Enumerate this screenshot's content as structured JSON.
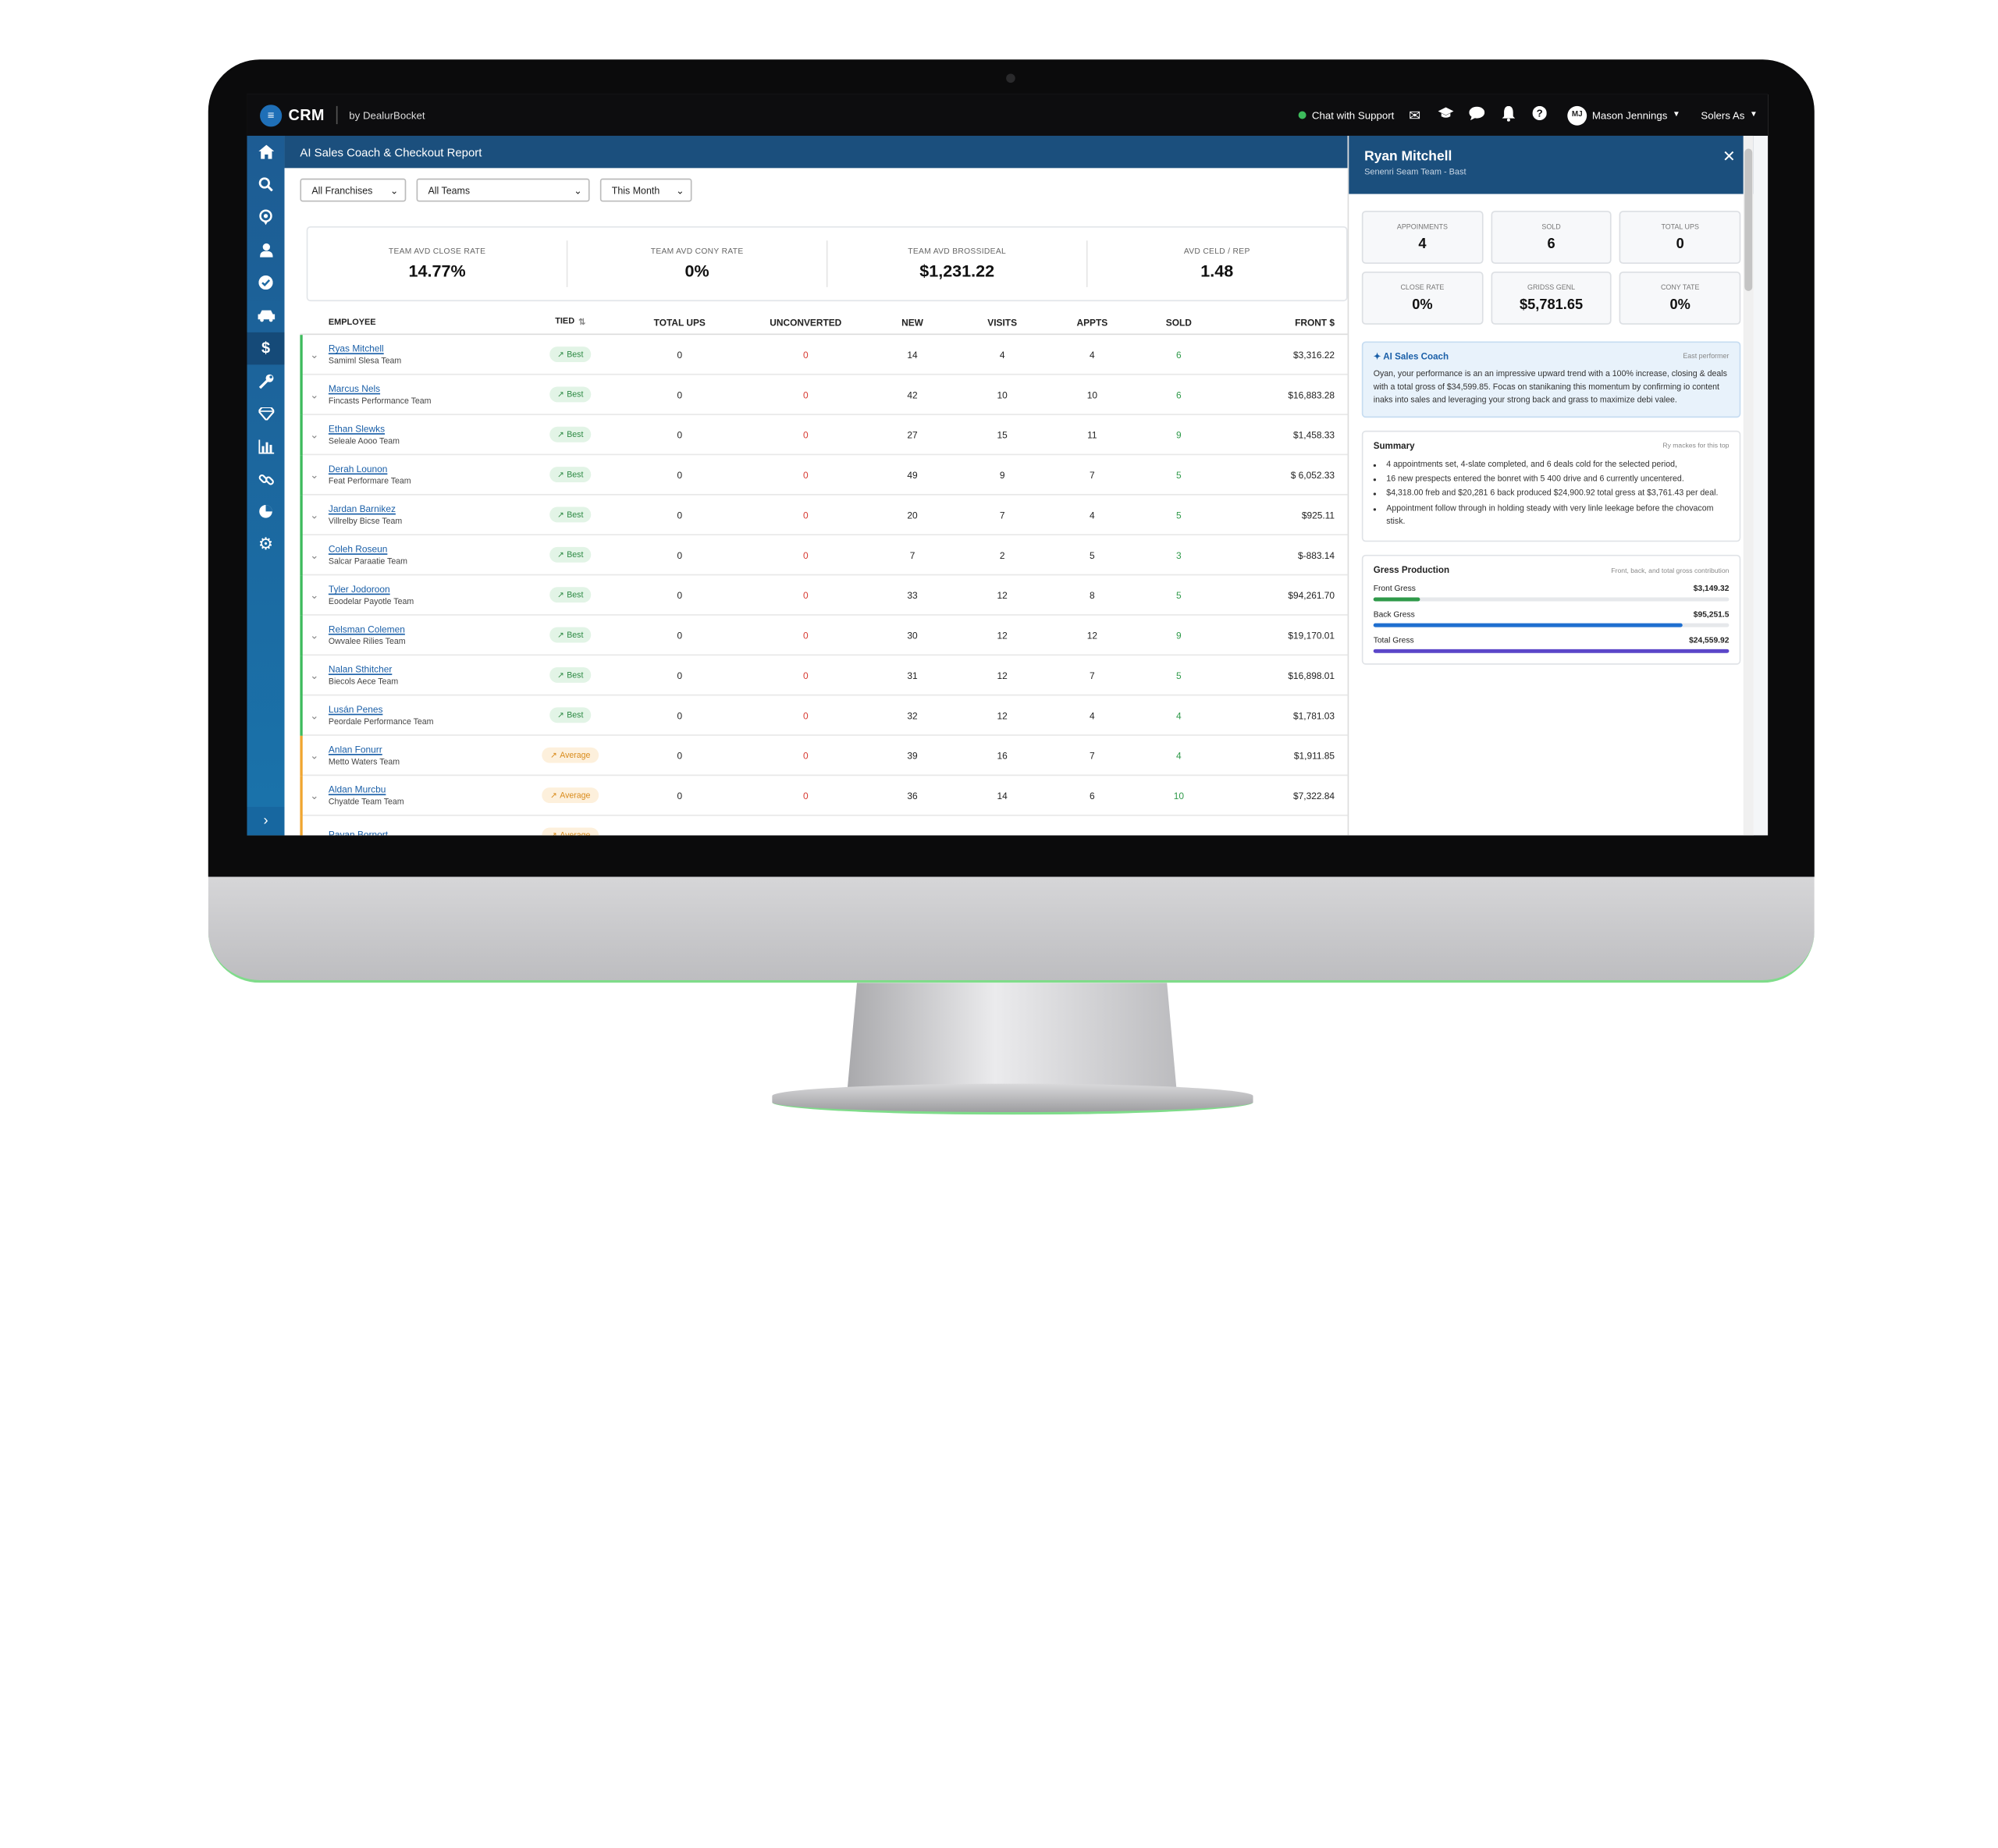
{
  "app": {
    "logo_text": "CRM",
    "by_text": "by DealurBocket",
    "page_title": "AI Sales Coach & Checkout Report"
  },
  "topbar": {
    "chat_label": "Chat with Support",
    "user_initials": "MJ",
    "user_name": "Mason Jennings",
    "store_label": "Solers As"
  },
  "icons": {
    "mail": "mail-icon",
    "education": "graduation-cap-icon",
    "chat": "chat-bubble-icon",
    "bell": "bell-icon",
    "help": "help-icon"
  },
  "sidebar": {
    "items": [
      "home-icon",
      "search-icon",
      "location-icon",
      "user-icon",
      "check-circle-icon",
      "car-icon",
      "dollar-icon",
      "wrench-icon",
      "diamond-icon",
      "bar-chart-icon",
      "link-icon",
      "pie-chart-icon",
      "gear-icon"
    ],
    "active_index": 6,
    "expand": "chevron-right-icon"
  },
  "filters": {
    "franchise": "All Franchises",
    "team": "All Teams",
    "period": "This Month"
  },
  "kpis": [
    {
      "label": "TEAM AVD CLOSE RATE",
      "value": "14.77%"
    },
    {
      "label": "TEAM AVD CONY RATE",
      "value": "0%"
    },
    {
      "label": "TEAM AVD BROSSIDEAL",
      "value": "$1,231.22"
    },
    {
      "label": "AVD CELD / REP",
      "value": "1.48"
    }
  ],
  "table": {
    "headers": {
      "employee": "EMPLOYEE",
      "tied": "TIED",
      "total_ups": "TOTAL UPS",
      "unconverted": "UNCONVERTED",
      "new": "NEW",
      "visits": "VISITS",
      "appts": "APPTS",
      "sold": "SOLD",
      "front": "FRONT $"
    },
    "rows": [
      {
        "name": "Ryas Mitchell",
        "team": "Samiml Slesa Team",
        "tier": "Best",
        "total_ups": "0",
        "unconverted": "0",
        "new": "14",
        "visits": "4",
        "appts": "4",
        "sold": "6",
        "front": "$3,316.22"
      },
      {
        "name": "Marcus Nels",
        "team": "Fincasts Performance Team",
        "tier": "Best",
        "total_ups": "0",
        "unconverted": "0",
        "new": "42",
        "visits": "10",
        "appts": "10",
        "sold": "6",
        "front": "$16,883.28"
      },
      {
        "name": "Ethan Slewks",
        "team": "Seleale Aooo Team",
        "tier": "Best",
        "total_ups": "0",
        "unconverted": "0",
        "new": "27",
        "visits": "15",
        "appts": "11",
        "sold": "9",
        "front": "$1,458.33"
      },
      {
        "name": "Derah Lounon",
        "team": "Feat Performare Team",
        "tier": "Best",
        "total_ups": "0",
        "unconverted": "0",
        "new": "49",
        "visits": "9",
        "appts": "7",
        "sold": "5",
        "front": "$ 6,052.33"
      },
      {
        "name": "Jardan Barnikez",
        "team": "Villrelby Bicse Team",
        "tier": "Best",
        "total_ups": "0",
        "unconverted": "0",
        "new": "20",
        "visits": "7",
        "appts": "4",
        "sold": "5",
        "front": "$925.11"
      },
      {
        "name": "Coleh Roseun",
        "team": "Salcar Paraatie Team",
        "tier": "Best",
        "total_ups": "0",
        "unconverted": "0",
        "new": "7",
        "visits": "2",
        "appts": "5",
        "sold": "3",
        "front": "$-883.14"
      },
      {
        "name": "Tyler Jodoroon",
        "team": "Eoodelar Payotle Team",
        "tier": "Best",
        "total_ups": "0",
        "unconverted": "0",
        "new": "33",
        "visits": "12",
        "appts": "8",
        "sold": "5",
        "front": "$94,261.70"
      },
      {
        "name": "Relsman Colemen",
        "team": "Owvalee Rilies Team",
        "tier": "Best",
        "total_ups": "0",
        "unconverted": "0",
        "new": "30",
        "visits": "12",
        "appts": "12",
        "sold": "9",
        "front": "$19,170.01"
      },
      {
        "name": "Nalan Sthitcher",
        "team": "Biecols Aece Team",
        "tier": "Best",
        "total_ups": "0",
        "unconverted": "0",
        "new": "31",
        "visits": "12",
        "appts": "7",
        "sold": "5",
        "front": "$16,898.01"
      },
      {
        "name": "Lusán Penes",
        "team": "Peordale Performance Team",
        "tier": "Best",
        "total_ups": "0",
        "unconverted": "0",
        "new": "32",
        "visits": "12",
        "appts": "4",
        "sold": "4",
        "front": "$1,781.03"
      },
      {
        "name": "Anlan Fonurr",
        "team": "Metto Waters Team",
        "tier": "Average",
        "total_ups": "0",
        "unconverted": "0",
        "new": "39",
        "visits": "16",
        "appts": "7",
        "sold": "4",
        "front": "$1,911.85"
      },
      {
        "name": "Aldan Murcbu",
        "team": "Chyatde Team Team",
        "tier": "Average",
        "total_ups": "0",
        "unconverted": "0",
        "new": "36",
        "visits": "14",
        "appts": "6",
        "sold": "10",
        "front": "$7,322.84"
      },
      {
        "name": "Pavan Bornort",
        "team": "",
        "tier": "Average",
        "total_ups": "",
        "unconverted": "",
        "new": "",
        "visits": "",
        "appts": "",
        "sold": "",
        "front": ""
      }
    ]
  },
  "panel": {
    "name": "Ryan Mitchell",
    "subtitle": "Senenri Seam Team - Bast",
    "stats": [
      {
        "label": "APPOINMENTS",
        "value": "4"
      },
      {
        "label": "SOLD",
        "value": "6"
      },
      {
        "label": "TOTAL UPS",
        "value": "0"
      },
      {
        "label": "CLOSE RATE",
        "value": "0%"
      },
      {
        "label": "GRIDSS GENL",
        "value": "$5,781.65"
      },
      {
        "label": "CONY TATE",
        "value": "0%"
      }
    ],
    "coach": {
      "title": "AI Sales Coach",
      "tag": "East performer",
      "text": "Oyan, your performance is an an impressive upward trend with a 100% increase, closing & deals with a total gross of $34,599.85. Focas on stanikaning this momentum by confirming io content inaks into sales and leveraging your strong back and grass to maximize debi valee."
    },
    "summary": {
      "title": "Summary",
      "note": "Ry mackes for this top",
      "items": [
        "4 appointments set, 4-slate completed, and 6 deals cold for the selected period,",
        "16 new prespects entered the bonret with 5 400 drive and 6 currently uncentered.",
        "$4,318.00 freb and $20,281 6 back produced $24,900.92 total gress at $3,761.43 per deal.",
        "Appointment follow through in holding steady with very linle leekage before the chovacom stisk."
      ]
    },
    "gross": {
      "title": "Gress Production",
      "note": "Front, back, and total gross contribution",
      "rows": [
        {
          "label": "Front Gress",
          "value": "$3,149.32",
          "pct": 0.13,
          "color": "#2f9a4a"
        },
        {
          "label": "Back Gress",
          "value": "$95,251.5",
          "pct": 0.87,
          "color": "#1f6fd0"
        },
        {
          "label": "Total Gress",
          "value": "$24,559.92",
          "pct": 1.0,
          "color": "#5b46c9"
        }
      ]
    }
  }
}
